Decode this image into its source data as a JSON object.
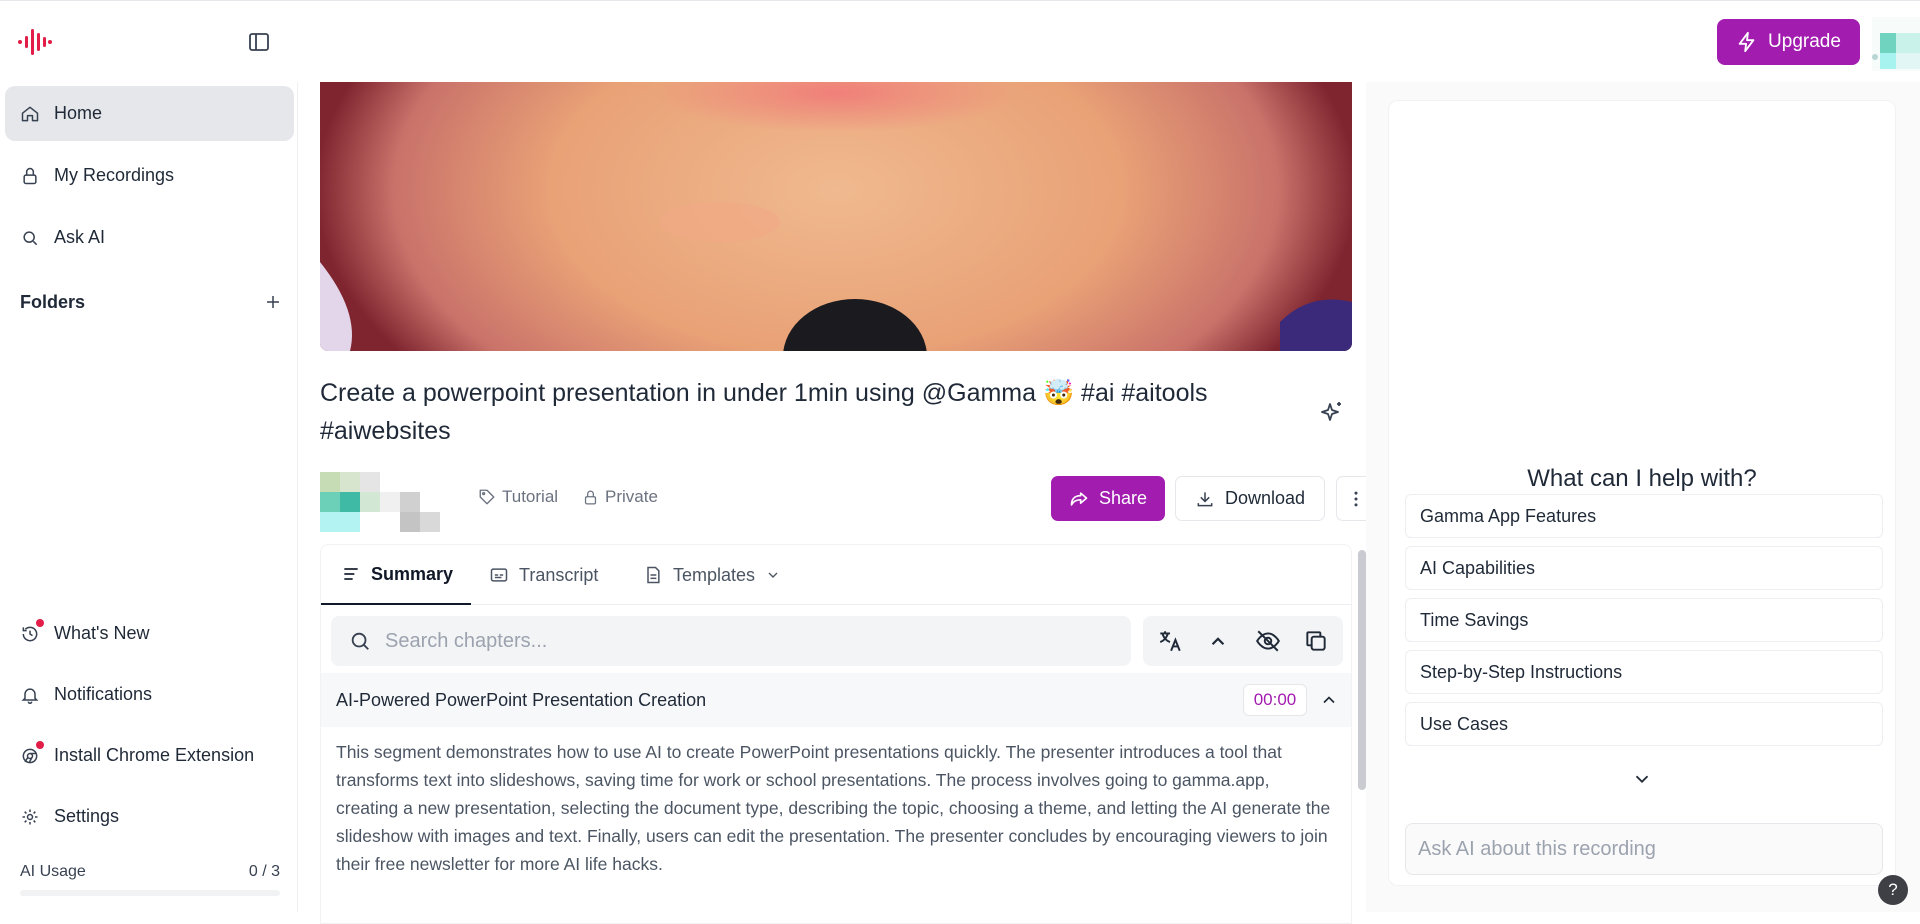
{
  "topbar": {
    "logo_icon": "soundwave-logo-icon",
    "sidebar_toggle_icon": "sidebar-panel-icon",
    "upgrade_label": "Upgrade",
    "upgrade_icon": "lightning-icon",
    "accent_color": "#a21caf"
  },
  "sidebar": {
    "items": [
      {
        "label": "Home",
        "icon": "home-icon",
        "active": true
      },
      {
        "label": "My Recordings",
        "icon": "lock-icon"
      },
      {
        "label": "Ask AI",
        "icon": "search-icon"
      }
    ],
    "folders_label": "Folders",
    "bottom_items": [
      {
        "label": "What's New",
        "icon": "history-icon",
        "badge": true
      },
      {
        "label": "Notifications",
        "icon": "bell-icon"
      },
      {
        "label": "Install Chrome Extension",
        "icon": "chrome-icon",
        "badge": true
      },
      {
        "label": "Settings",
        "icon": "gear-icon"
      }
    ],
    "usage": {
      "label": "AI Usage",
      "value": "0 / 3",
      "fraction": 0
    }
  },
  "recording": {
    "title": "Create a powerpoint presentation in under 1min using @Gamma 🤯 #ai #aitools #aiwebsites",
    "tag_label": "Tutorial",
    "privacy_label": "Private",
    "share_label": "Share",
    "download_label": "Download"
  },
  "tabs": [
    {
      "label": "Summary",
      "icon": "lines-icon",
      "active": true
    },
    {
      "label": "Transcript",
      "icon": "captions-icon"
    },
    {
      "label": "Templates",
      "icon": "document-icon"
    }
  ],
  "chapters": {
    "search_placeholder": "Search chapters...",
    "items": [
      {
        "title": "AI-Powered PowerPoint Presentation Creation",
        "timestamp": "00:00",
        "body": "This segment demonstrates how to use AI to create PowerPoint presentations quickly. The presenter introduces a tool that transforms text into slideshows, saving time for work or school presentations.  The process involves going to gamma.app, creating a new presentation, selecting the document type, describing the topic, choosing a theme, and letting the AI generate the slideshow with images and text.  Finally, users can edit the presentation. The presenter concludes by encouraging viewers to join their free newsletter for more AI life hacks."
      }
    ]
  },
  "chat": {
    "heading": "What can I help with?",
    "suggestions": [
      "Gamma App Features",
      "AI Capabilities",
      "Time Savings",
      "Step-by-Step Instructions",
      "Use Cases"
    ],
    "input_placeholder": "Ask AI about this recording"
  },
  "help_label": "?"
}
